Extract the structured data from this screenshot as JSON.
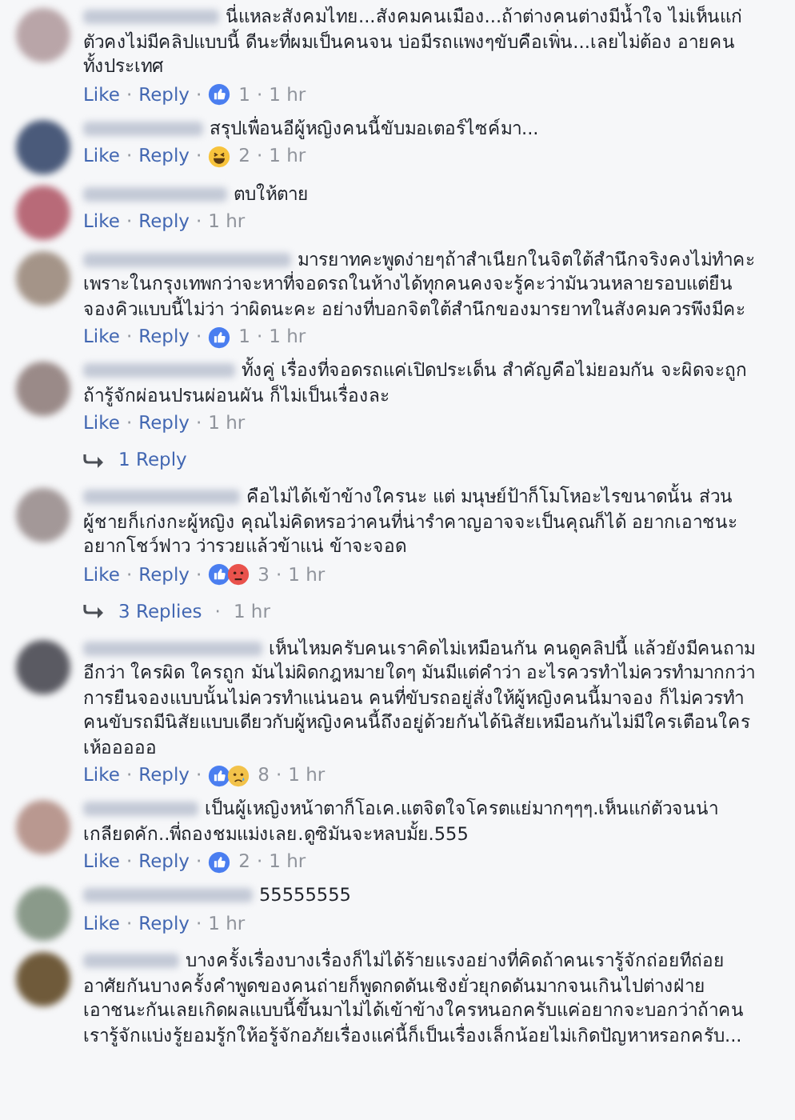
{
  "separator": "·",
  "comments": [
    {
      "lines": [
        "นี่แหละสังคมไทย...สังคมคนเมือง...ถ้าต่างคนต่างมีน้ำใจ ไม่เห็นแก่",
        "ตัวคงไม่มีคลิปแบบนี้ ดีนะที่ผมเป็นคนจน บ่อมีรถแพงๆขับคือเพิ่น...เลยไม่ต้อง อายคน",
        "ทั้งประเทศ"
      ],
      "like": "Like",
      "reply": "Reply",
      "reactions": [
        {
          "kind": "like"
        }
      ],
      "count": "1",
      "time": "1 hr"
    },
    {
      "lines": [
        "สรุปเพื่อนอีผู้หญิงคนนี้ขับมอเตอร์ไซค์มา..."
      ],
      "like": "Like",
      "reply": "Reply",
      "reactions": [
        {
          "kind": "haha"
        }
      ],
      "count": "2",
      "time": "1 hr"
    },
    {
      "lines": [
        "ตบให้ตาย"
      ],
      "like": "Like",
      "reply": "Reply",
      "time": "1 hr"
    },
    {
      "lines": [
        "มารยาทคะพูดง่ายๆถ้าสำเนียกในจิตใต้สำนึกจริงคงไม่ทำคะ",
        "เพราะในกรุงเทพกว่าจะหาที่จอดรถในห้างได้ทุกคนคงจะรู้คะว่ามันวนหลายรอบแต่ยืน",
        "จองคิวแบบนี้ไม่ว่า ว่าผิดนะคะ อย่างที่บอกจิตใต้สำนึกของมารยาทในสังคมควรพึงมีคะ"
      ],
      "like": "Like",
      "reply": "Reply",
      "reactions": [
        {
          "kind": "like"
        }
      ],
      "count": "1",
      "time": "1 hr"
    },
    {
      "lines": [
        "ทั้งคู่ เรื่องที่จอดรถแค่เปิดประเด็น สำคัญคือไม่ยอมกัน จะผิดจะถูก",
        "ถ้ารู้จักผ่อนปรนผ่อนผัน ก็ไม่เป็นเรื่องละ"
      ],
      "like": "Like",
      "reply": "Reply",
      "time": "1 hr",
      "replies": {
        "label": "1 Reply"
      }
    },
    {
      "lines": [
        "คือไม่ได้เข้าข้างใครนะ แต่ มนุษย์ป้าก็โมโหอะไรขนาดนั้น ส่วน",
        "ผู้ชายก็เก่งกะผู้หญิง คุณไม่คิดหรอว่าคนที่น่ารำคาญอาจจะเป็นคุณก็ได้ อยากเอาชนะ",
        "อยากโชว์ฟาว ว่ารวยแล้วข้าแน่ ข้าจะจอด"
      ],
      "like": "Like",
      "reply": "Reply",
      "reactions": [
        {
          "kind": "like"
        },
        {
          "kind": "angry"
        }
      ],
      "count": "3",
      "time": "1 hr",
      "replies": {
        "label": "3 Replies",
        "time": "1 hr"
      }
    },
    {
      "lines": [
        "เห็นไหมครับคนเราคิดไม่เหมือนกัน คนดูคลิปนี้ แล้วยังมีคนถาม",
        "อีกว่า ใครผิด ใครถูก มันไม่ผิดกฎหมายใดๆ มันมีแต่คำว่า อะไรควรทำไม่ควรทำมากกว่า",
        "การยืนจองแบบนั้นไม่ควรทำแน่นอน คนที่ขับรถอยู่สั่งให้ผู้หญิงคนนี้มาจอง ก็ไม่ควรทำ",
        "คนขับรถมีนิสัยแบบเดียวกับผู้หญิงคนนี้ถึงอยู่ด้วยกันได้นิสัยเหมือนกันไม่มีใครเตือนใคร",
        "เห้อออออ"
      ],
      "like": "Like",
      "reply": "Reply",
      "reactions": [
        {
          "kind": "like"
        },
        {
          "kind": "sad"
        }
      ],
      "count": "8",
      "time": "1 hr"
    },
    {
      "lines": [
        "เป็นผู้เหญิงหน้าตาก็โอเค.แตจิตใจโครตแย่มากๆๆๆ.เห็นแก่ตัวจนน่า",
        "เกลียดคัก..พี่ถองชมแม่งเลย.ดูซิมันจะหลบมั้ย.555"
      ],
      "like": "Like",
      "reply": "Reply",
      "reactions": [
        {
          "kind": "like"
        }
      ],
      "count": "2",
      "time": "1 hr"
    },
    {
      "lines": [
        "55555555"
      ],
      "like": "Like",
      "reply": "Reply",
      "time": "1 hr"
    },
    {
      "lines": [
        "บางครั้งเรื่องบางเรื่องก็ไม่ได้ร้ายแรงอย่างที่คิดถ้าคนเรารู้จักถ่อยทีถ่อย",
        "อาศัยกันบางครั้งคำพูดของคนถ่ายก็พูดกดดันเชิงยั่วยุกดดันมากจนเกินไปต่างฝ่าย",
        "เอาชนะกันเลยเกิดผลแบบนี้ขึ้นมาไม่ได้เข้าข้างใครหนอกครับแค่อยากจะบอกว่าถ้าคน",
        "เรารู้จักแบ่งรู้ยอมรู้กให้อรู้จักอภัยเรื่องแค่นี้ก็เป็นเรื่องเล็กน้อยไม่เกิดปัญหาหรอกครับ..."
      ]
    }
  ]
}
